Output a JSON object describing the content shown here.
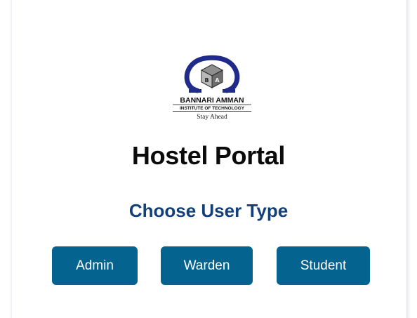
{
  "logo": {
    "institution_name": "BANNARI AMMAN",
    "institution_sub": "INSTITUTE OF TECHNOLOGY",
    "tagline": "Stay Ahead",
    "monogram": "BA",
    "accent_color": "#1f2a8a",
    "icon": "omega-cube-logo"
  },
  "header": {
    "title": "Hostel Portal"
  },
  "chooser": {
    "heading": "Choose User Type",
    "buttons": [
      "Admin",
      "Warden",
      "Student"
    ]
  },
  "colors": {
    "title": "#0b0b0b",
    "subtitle": "#14407a",
    "button_bg": "#05638f",
    "button_text": "#ffffff"
  }
}
